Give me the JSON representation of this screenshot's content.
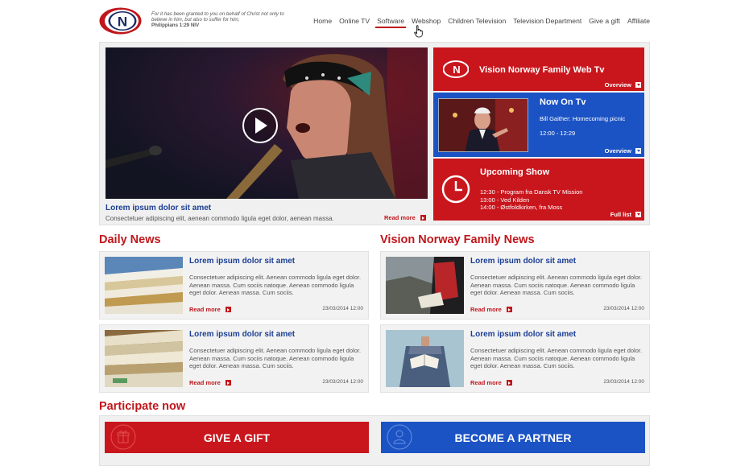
{
  "header": {
    "logo_letter": "N",
    "verse_text": "For it has been granted to you on behalf of Christ not only to believe in him, but also to suffer for him,",
    "verse_ref": "Philippians 1:29 NIV",
    "nav": [
      "Home",
      "Online TV",
      "Software",
      "Webshop",
      "Children Television",
      "Television Department",
      "Give a gift",
      "Affiliate"
    ],
    "active_nav": "Software"
  },
  "hero": {
    "title": "Lorem ipsum dolor sit amet",
    "description": "Consectetuer adipiscing elit, aenean commodo ligula eget dolor, aenean massa.",
    "read_more": "Read more"
  },
  "panels": {
    "web_tv": {
      "title": "Vision Norway Family Web Tv",
      "link": "Overview"
    },
    "now_on_tv": {
      "title": "Now On Tv",
      "program": "Bill Gaither: Homecoming picnic",
      "time": "12:00 - 12:29",
      "link": "Overview"
    },
    "upcoming": {
      "title": "Upcoming Show",
      "items": [
        "12:30  - Program fra Dansk TV Mission",
        "13:00  - Ved Kilden",
        "14:00  - Østfoldkirken, fra Moss"
      ],
      "link": "Full list"
    }
  },
  "daily_news": {
    "heading": "Daily News",
    "cards": [
      {
        "title": "Lorem ipsum dolor sit amet",
        "text": "Consectetuer adipiscing elit. Aenean commodo ligula eget dolor. Aenean massa. Cum sociis natoque. Aenean commodo ligula eget dolor. Aenean massa. Cum sociis.",
        "read_more": "Read more",
        "date": "23/03/2014 12:00"
      },
      {
        "title": "Lorem ipsum dolor sit amet",
        "text": "Consectetuer adipiscing elit. Aenean commodo ligula eget dolor. Aenean massa. Cum sociis natoque. Aenean commodo ligula eget dolor. Aenean massa. Cum sociis.",
        "read_more": "Read more",
        "date": "23/03/2014 12:00"
      }
    ]
  },
  "family_news": {
    "heading": "Vision Norway Family News",
    "cards": [
      {
        "title": "Lorem ipsum dolor sit amet",
        "text": "Consectetuer adipiscing elit. Aenean commodo ligula eget dolor. Aenean massa. Cum sociis natoque. Aenean commodo ligula eget dolor. Aenean massa. Cum sociis.",
        "read_more": "Read more",
        "date": "23/03/2014 12:00"
      },
      {
        "title": "Lorem ipsum dolor sit amet",
        "text": "Consectetuer adipiscing elit. Aenean commodo ligula eget dolor. Aenean massa. Cum sociis natoque. Aenean commodo ligula eget dolor. Aenean massa. Cum sociis.",
        "read_more": "Read more",
        "date": "23/03/2014 12:00"
      }
    ]
  },
  "participate": {
    "heading": "Participate now",
    "gift_button": "GIVE A GIFT",
    "partner_button": "BECOME A PARTNER"
  },
  "colors": {
    "brand_red": "#c9161d",
    "brand_blue": "#1c53c4",
    "link_blue": "#1c3f94"
  }
}
